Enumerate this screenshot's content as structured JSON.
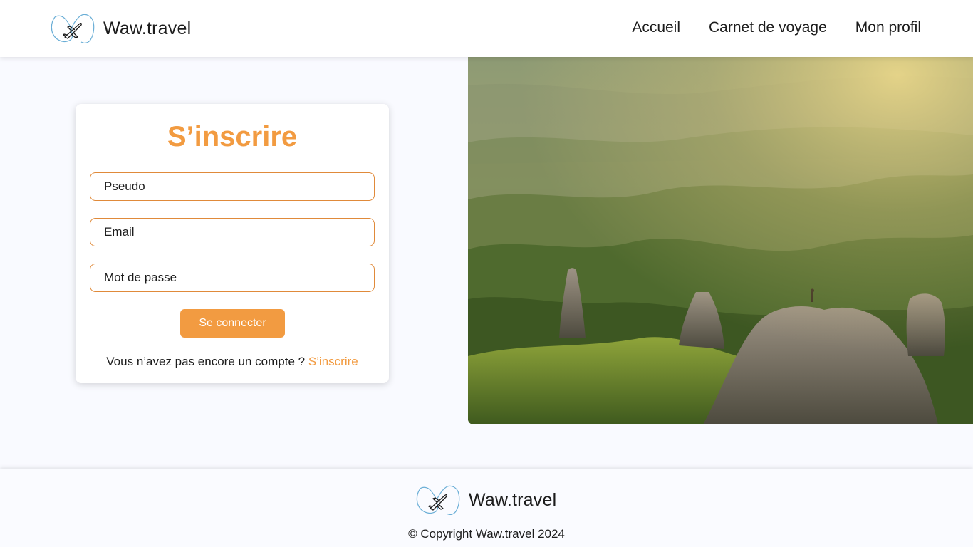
{
  "brand": {
    "name": "Waw.travel",
    "logo_icon": "airplane-heart-icon"
  },
  "nav": {
    "home": "Accueil",
    "travel_journal": "Carnet de voyage",
    "profile": "Mon profil"
  },
  "signup": {
    "title": "S’inscrire",
    "username_placeholder": "Pseudo",
    "email_placeholder": "Email",
    "password_placeholder": "Mot de passe",
    "submit_label": "Se connecter",
    "footer_prompt": "Vous n’avez pas encore un compte ?",
    "footer_link": "S’inscrire"
  },
  "hero": {
    "image": "mountain-landscape-hiker"
  },
  "footer": {
    "copyright": "© Copyright Waw.travel 2024"
  },
  "colors": {
    "accent": "#f29b41",
    "field_border": "#e08a3a",
    "background": "#f9faff",
    "logo_stroke": "#6aaed6"
  }
}
